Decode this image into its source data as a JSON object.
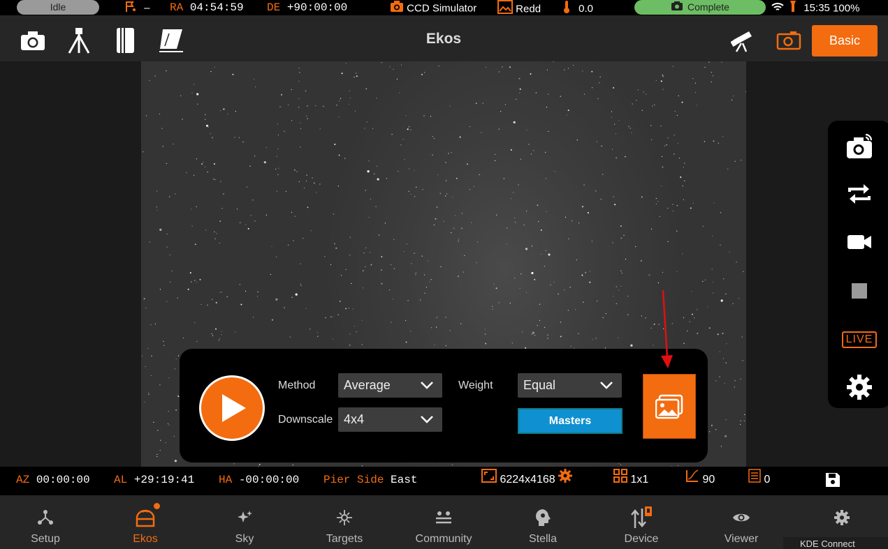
{
  "status_bar": {
    "state": "Idle",
    "target_value": "–",
    "ra_label": "RA",
    "ra_value": "04:54:59",
    "de_label": "DE",
    "de_value": "+90:00:00",
    "camera": "CCD Simulator",
    "filter": "Redd",
    "temperature": "0.0",
    "capture_status": "Complete",
    "time": "15:35",
    "battery": "100%"
  },
  "toolbar": {
    "title": "Ekos",
    "mode_button": "Basic"
  },
  "controls": {
    "method_label": "Method",
    "method_value": "Average",
    "downscale_label": "Downscale",
    "downscale_value": "4x4",
    "weight_label": "Weight",
    "weight_value": "Equal",
    "masters_button": "Masters"
  },
  "side_panel": {
    "live_label": "LIVE"
  },
  "info_bar": {
    "az_label": "AZ",
    "az_value": "00:00:00",
    "al_label": "AL",
    "al_value": "+29:19:41",
    "ha_label": "HA",
    "ha_value": "-00:00:00",
    "pier_label": "Pier Side",
    "pier_value": "East",
    "resolution": "6224x4168",
    "binning": "1x1",
    "gain": "90",
    "offset": "0"
  },
  "nav": {
    "items": [
      {
        "label": "Setup",
        "icon": "setup-icon"
      },
      {
        "label": "Ekos",
        "icon": "ekos-icon"
      },
      {
        "label": "Sky",
        "icon": "sky-icon"
      },
      {
        "label": "Targets",
        "icon": "targets-icon"
      },
      {
        "label": "Community",
        "icon": "community-icon"
      },
      {
        "label": "Stella",
        "icon": "stella-icon"
      },
      {
        "label": "Device",
        "icon": "device-icon"
      },
      {
        "label": "Viewer",
        "icon": "viewer-icon"
      },
      {
        "label": "",
        "icon": "settings-icon"
      }
    ],
    "active": "Ekos"
  },
  "notification": "KDE Connect",
  "colors": {
    "accent": "#f36c10",
    "masters": "#0f90d0",
    "complete": "#6cbd63",
    "annotation_arrow": "#e01010"
  }
}
